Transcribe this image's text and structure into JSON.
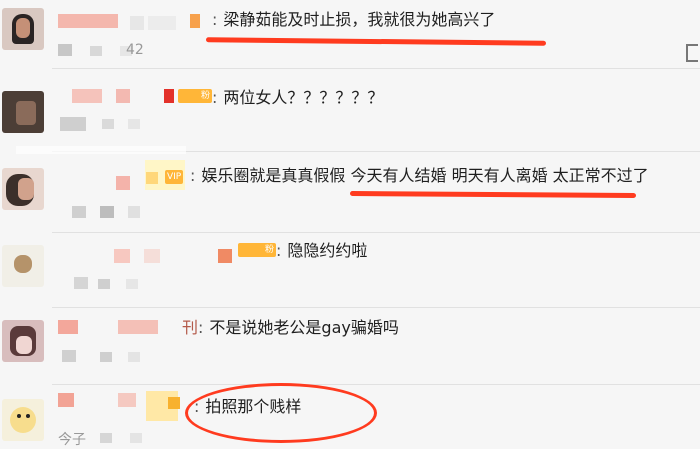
{
  "comments": [
    {
      "text": "梁静茹能及时止损，我就很为她高兴了",
      "meta": "42"
    },
    {
      "text": "两位女人？？？？？？"
    },
    {
      "text": "娱乐圈就是真真假假 今天有人结婚 明天有人离婚 太正常不过了",
      "badge": "VIP"
    },
    {
      "text": "隐隐约约啦",
      "badge": "粉"
    },
    {
      "text": "不是说她老公是gay骗婚吗",
      "user_tail": "刊"
    },
    {
      "text": "拍照那个贱样",
      "meta": "今子"
    }
  ],
  "badges": {
    "row2": "粉"
  },
  "colors": {
    "annotation": "#ff3b1f",
    "badge": "#ffb638",
    "background": "#f6f6f6"
  }
}
